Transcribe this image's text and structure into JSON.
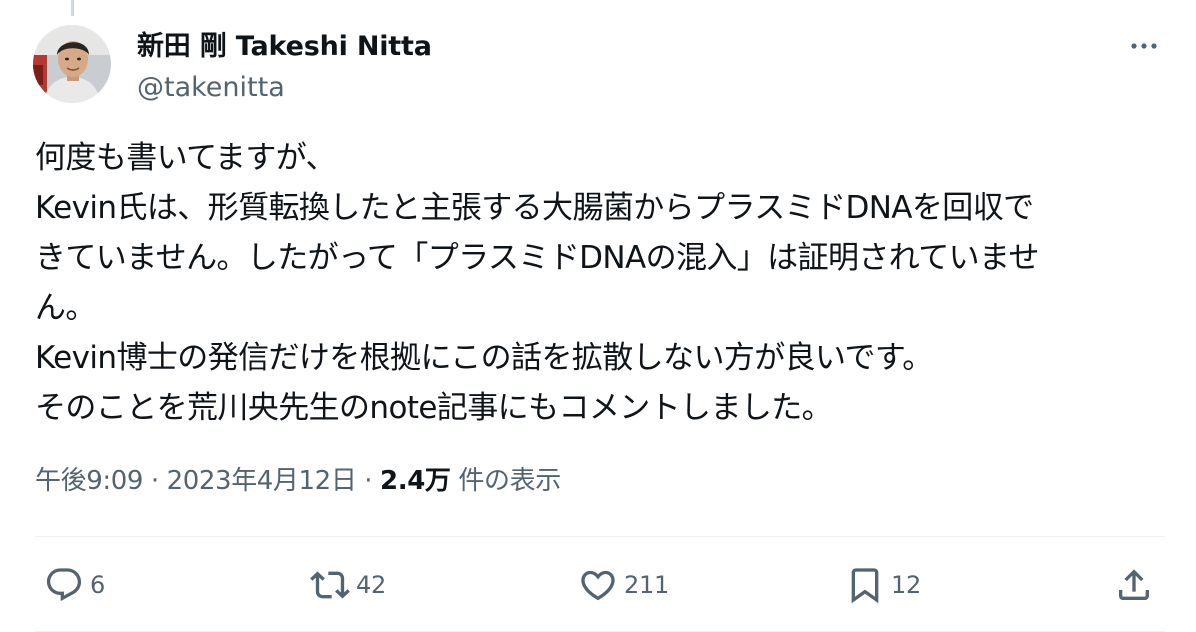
{
  "author": {
    "display_name": "新田 剛 Takeshi Nitta",
    "handle": "@takenitta"
  },
  "tweet": {
    "lines": [
      "何度も書いてますが、",
      "Kevin氏は、形質転換したと主張する大腸菌からプラスミドDNAを回収で",
      "きていません。したがって「プラスミドDNAの混入」は証明されていませ",
      "ん。",
      "Kevin博士の発信だけを根拠にこの話を拡散しない方が良いです。",
      "そのことを荒川央先生のnote記事にもコメントしました。"
    ]
  },
  "meta": {
    "time": "午後9:09",
    "separator": "·",
    "date": "2023年4月12日",
    "views_count": "2.4万",
    "views_label": "件の表示"
  },
  "actions": {
    "reply": {
      "icon": "reply-icon",
      "count": "6"
    },
    "retweet": {
      "icon": "retweet-icon",
      "count": "42"
    },
    "like": {
      "icon": "heart-icon",
      "count": "211"
    },
    "bookmark": {
      "icon": "bookmark-icon",
      "count": "12"
    },
    "share": {
      "icon": "share-icon"
    }
  },
  "colors": {
    "text": "#0f1419",
    "secondary": "#536471",
    "divider": "#eff3f4",
    "thread_line": "#cfd9de"
  }
}
